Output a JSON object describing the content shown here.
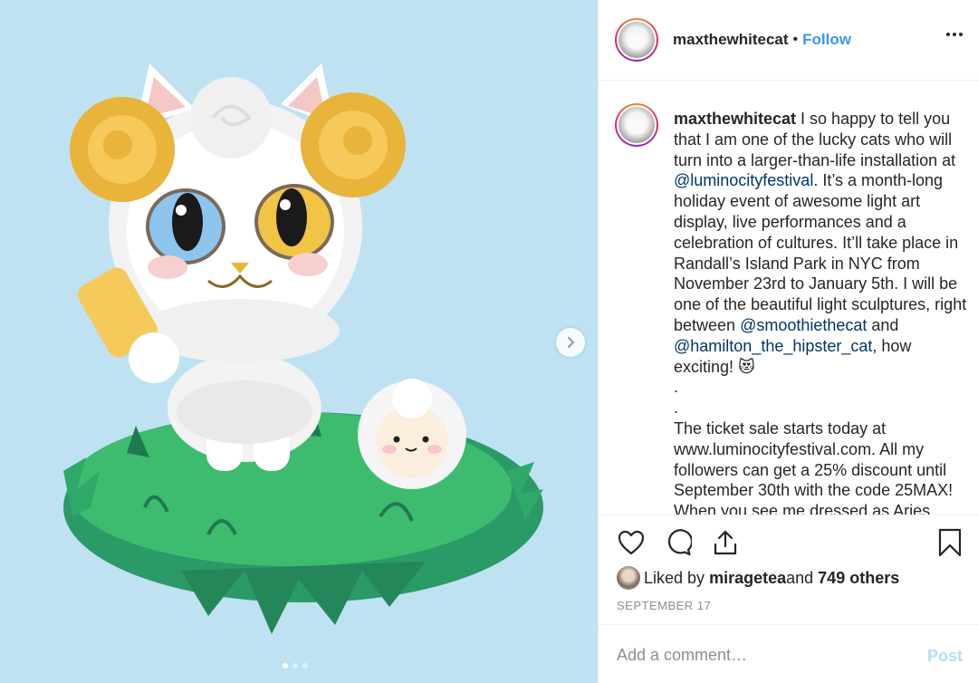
{
  "post": {
    "username": "maxthewhitecat",
    "separator": "•",
    "follow_label": "Follow",
    "more_icon": "more-horizontal-icon"
  },
  "caption": {
    "username": "maxthewhitecat",
    "seg1": " I so happy to tell you that I am one of the lucky cats who will turn into a larger-than-life installation at ",
    "mention1": "@luminocityfestival",
    "seg2": ". It’s a month-long holiday event of awesome light art display, live performances and a celebration of cultures. It’ll take place in Randall’s Island Park in NYC from November 23rd to January 5th. I will be one of the beautiful light sculptures, right between ",
    "mention2": "@smoothiethecat",
    "seg3": " and ",
    "mention3": "@hamilton_the_hipster_cat",
    "seg4": ", how exciting! 😻",
    "dot1": ".",
    "dot2": ".",
    "para2": "The ticket sale starts today at www.luminocityfestival.com. All my followers can get a 25% discount until September 30th with the code 25MAX!",
    "para3": "When you see me dressed as Aries"
  },
  "actions": {
    "like_icon": "heart-icon",
    "comment_icon": "comment-icon",
    "share_icon": "share-icon",
    "save_icon": "bookmark-icon"
  },
  "likes": {
    "prefix": "Liked by ",
    "user": "miragetea",
    "middle": " and ",
    "others": "749 others"
  },
  "date": "SEPTEMBER 17",
  "comment": {
    "placeholder": "Add a comment…",
    "post_label": "Post"
  },
  "carousel": {
    "current": 1,
    "total": 3
  },
  "colors": {
    "link": "#3897f0",
    "mention": "#003569",
    "background": "#bfe2f2"
  }
}
